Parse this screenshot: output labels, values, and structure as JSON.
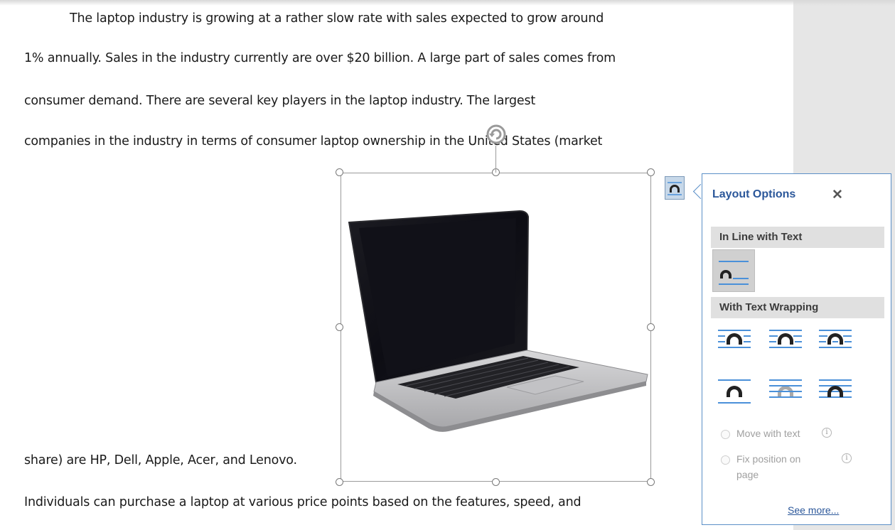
{
  "document": {
    "lines": [
      "The laptop industry is growing at a rather slow rate with sales expected to grow around",
      "1% annually.  Sales in the industry currently are over $20 billion.  A large part of sales comes from",
      "consumer demand.  There are several key players in the laptop industry.  The largest",
      "companies in the industry in terms of consumer laptop ownership in the United States (market",
      "share) are HP, Dell, Apple, Acer, and Lenovo.",
      "Individuals can purchase a laptop at various price points based on the features, speed, and"
    ]
  },
  "layout_options": {
    "title": "Layout Options",
    "close_label": "✕",
    "inline_section": "In Line with Text",
    "wrapping_section": "With Text Wrapping",
    "move_with_text": "Move with text",
    "fix_position_line1": "Fix position on",
    "fix_position_line2": "page",
    "see_more": "See more...",
    "accent_color": "#2b579a",
    "line_color": "#4a90d9"
  },
  "icons": [
    "rotate-handle-icon",
    "layout-options-icon",
    "close-icon",
    "info-icon"
  ]
}
